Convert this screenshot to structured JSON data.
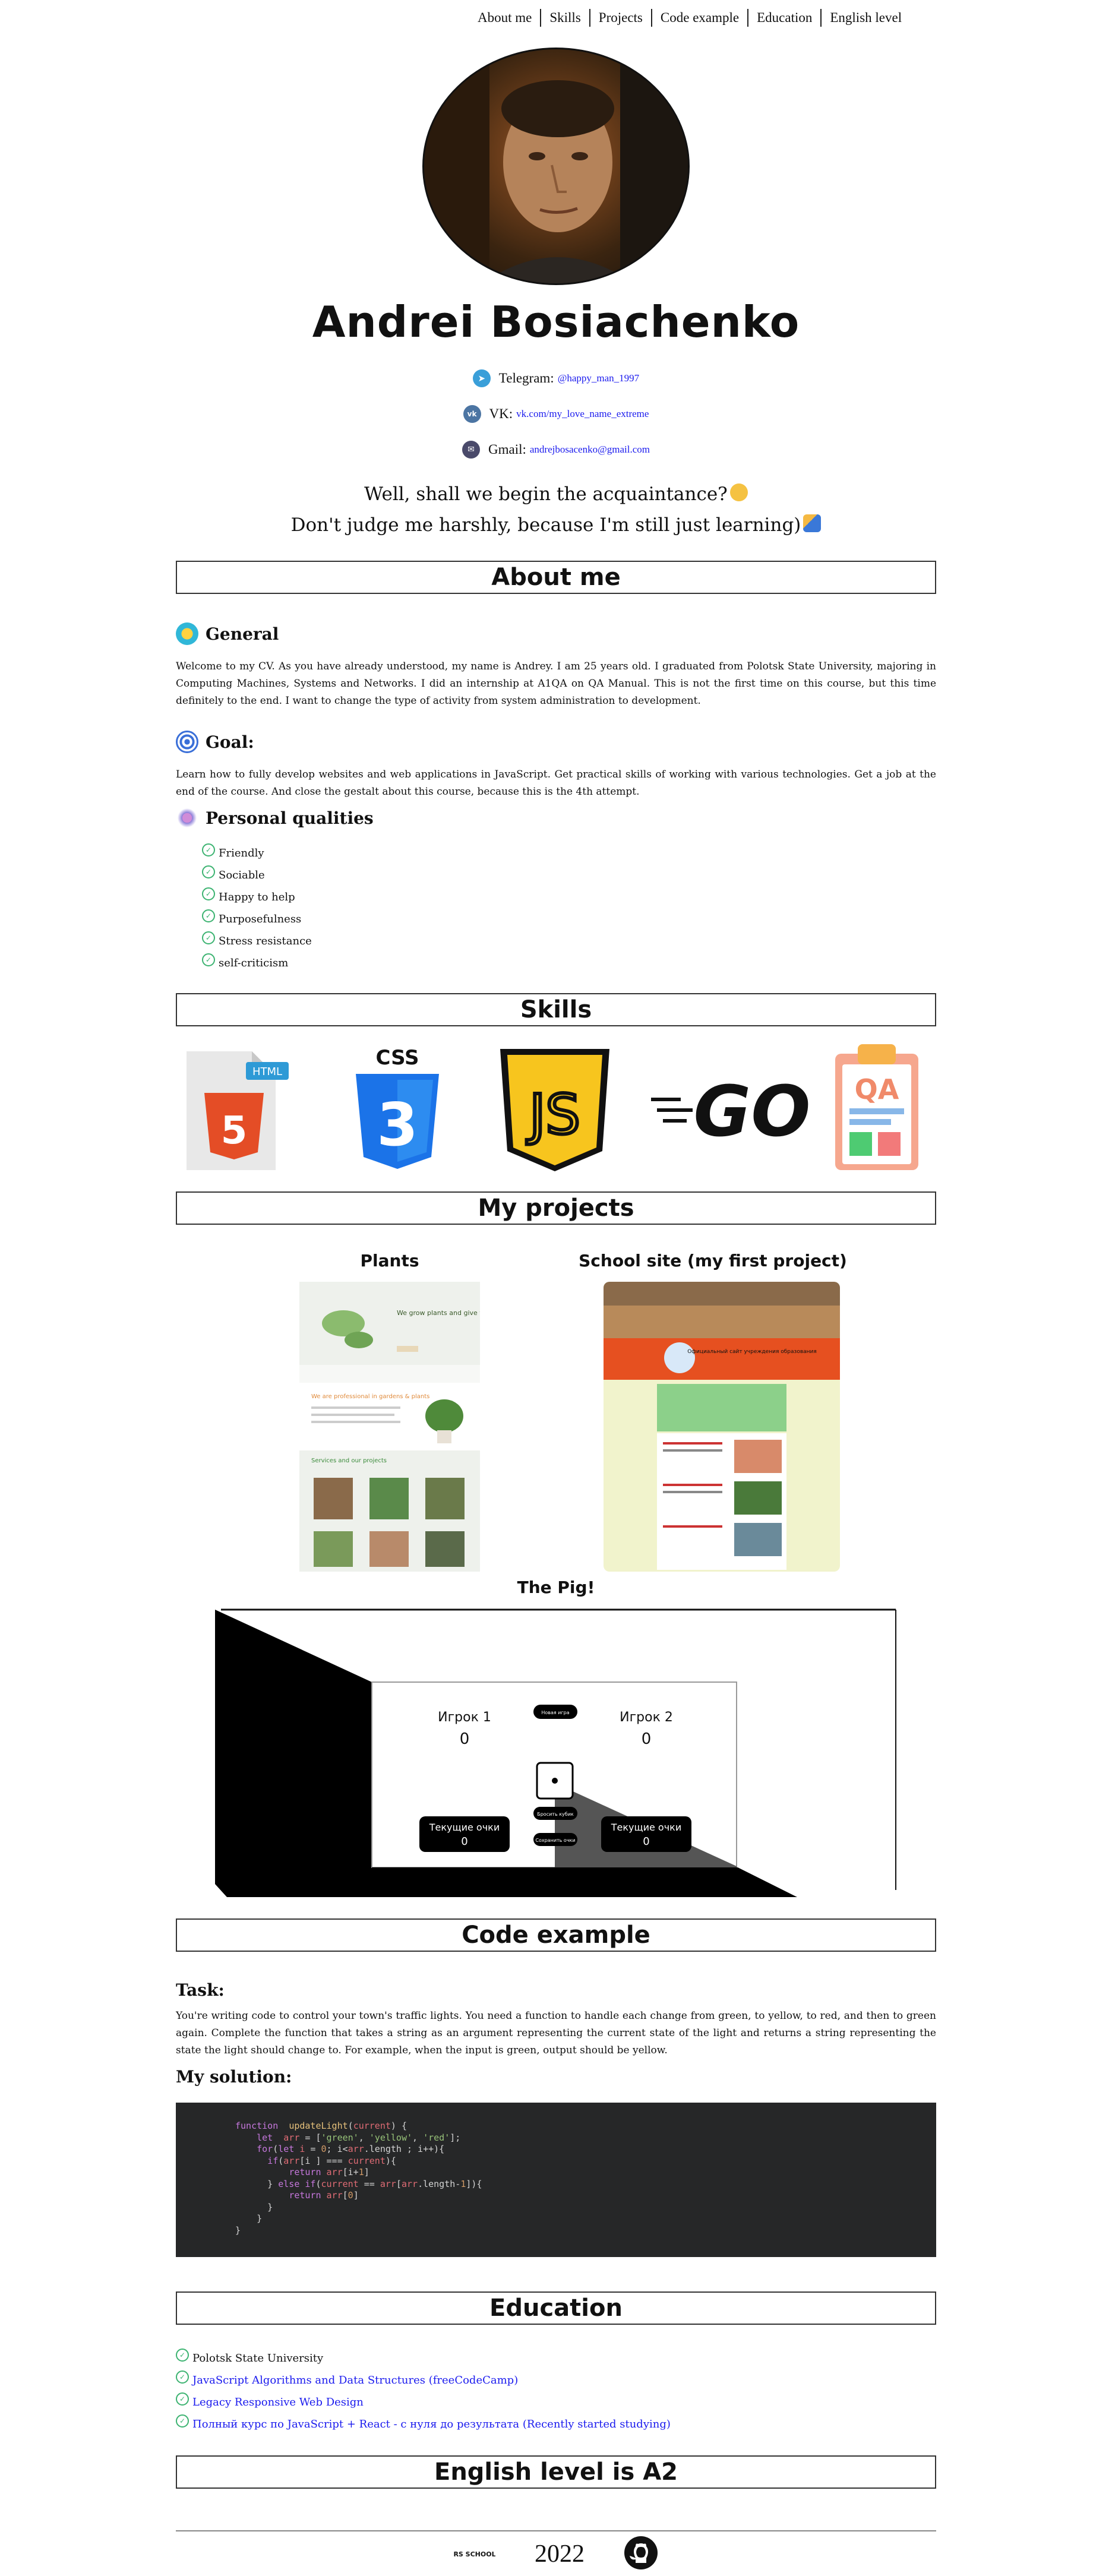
{
  "nav": [
    "About me",
    "Skills",
    "Projects",
    "Code example",
    "Education",
    "English level"
  ],
  "name": "Andrei Bosiachenko",
  "contacts": [
    {
      "label": "Telegram:",
      "value": "@happy_man_1997",
      "icon": "telegram-icon",
      "color": "#3a9fd9"
    },
    {
      "label": "VK:",
      "value": "vk.com/my_love_name_extreme",
      "icon": "vk-icon",
      "color": "#4c75a3"
    },
    {
      "label": "Gmail:",
      "value": "andrejbosacenko@gmail.com",
      "icon": "gmail-icon",
      "color": "#4a4a6a"
    }
  ],
  "greeting": {
    "line1": "Well, shall we begin the acquaintance?",
    "line2": "Don't judge me harshly, because I'm still just learning)"
  },
  "about": {
    "title": "About me",
    "general_title": "General",
    "general_text": "Welcome to my CV. As you have already understood, my name is Andrey. I am 25 years old. I graduated from Polotsk State University, majoring in Computing Machines, Systems and Networks. I did an internship at A1QA on QA Manual. This is not the first time on this course, but this time definitely to the end. I want to change the type of activity from system administration to development.",
    "goal_title": "Goal:",
    "goal_text": "Learn how to fully develop websites and web applications in JavaScript. Get practical skills of working with various technologies. Get a job at the end of the course. And close the gestalt about this course, because this is the 4th attempt.",
    "qualities_title": "Personal qualities",
    "qualities": [
      "Friendly",
      "Sociable",
      "Happy to help",
      "Purposefulness",
      "Stress resistance",
      "self-criticism"
    ]
  },
  "skills": {
    "title": "Skills",
    "html_badge": "HTML",
    "html_glyph": "5",
    "css_label": "CSS",
    "css_glyph": "3",
    "js_glyph": "JS",
    "go_label": "GO",
    "qa_label": "QA"
  },
  "projects": {
    "title": "My projects",
    "items": [
      "Plants",
      "School site (my first project)",
      "The Pig!"
    ],
    "plants_heading": "We grow plants and give you oxygen",
    "plants_subheading": "We are professional in gardens & plants",
    "plants_services": "Services and our projects",
    "school_heading": "Официальный сайт учреждения образования",
    "pig": {
      "player1": "Игрок 1",
      "player2": "Игрок 2",
      "score1": "0",
      "score2": "0",
      "current": "Текущие очки",
      "current1": "0",
      "current2": "0",
      "new_game": "Новая игра",
      "roll": "Бросить кубик",
      "hold": "Сохранить очки"
    }
  },
  "code": {
    "title": "Code example",
    "task_title": "Task:",
    "task_text": "You're writing code to control your town's traffic lights. You need a function to handle each change from green, to yellow, to red, and then to green again. Complete the function that takes a string as an argument representing the current state of the light and returns a string representing the state the light should change to. For example, when the input is green, output should be yellow.",
    "solution_title": "My solution:"
  },
  "education": {
    "title": "Education",
    "items": [
      {
        "text": "Polotsk State University",
        "link": false
      },
      {
        "text": "JavaScript Algorithms and Data Structures (freeCodeCamp)",
        "link": true
      },
      {
        "text": "Legacy Responsive Web Design",
        "link": true
      },
      {
        "text": "Полный курс по JavaScript + React - с нуля до результата (Recently started studying)",
        "link": true
      }
    ]
  },
  "english": {
    "title": "English level is A2"
  },
  "footer": {
    "year": "2022",
    "rs_logo": "RS SCHOOL"
  },
  "colors": {
    "link": "#1a1aee",
    "code_bg": "#262728",
    "check": "#3cb371"
  }
}
